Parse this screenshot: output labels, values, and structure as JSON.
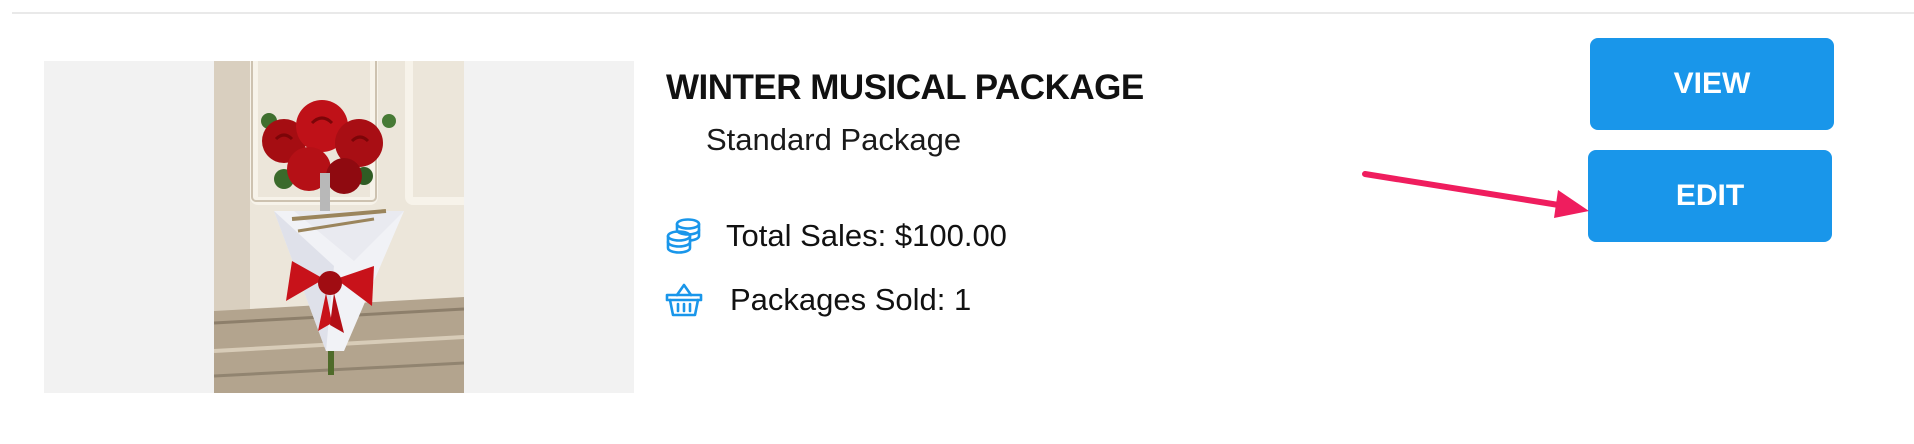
{
  "package": {
    "title": "WINTER MUSICAL PACKAGE",
    "subtitle": "Standard Package",
    "stats": {
      "total_sales": "Total Sales: $100.00",
      "packages_sold": "Packages Sold: 1"
    },
    "icons": {
      "sales": "coins-stack-icon",
      "sold": "shopping-basket-icon"
    }
  },
  "actions": {
    "view_label": "VIEW",
    "edit_label": "EDIT"
  },
  "colors": {
    "button_bg": "#1996ea",
    "icon": "#1996ea",
    "arrow": "#ef1d5e"
  }
}
